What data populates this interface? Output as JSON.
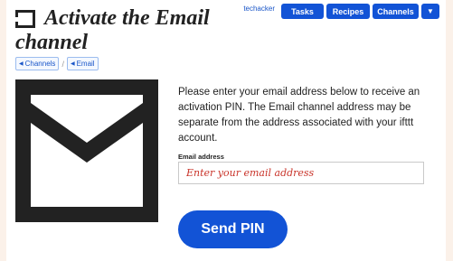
{
  "header": {
    "title_line1": "Activate the Email",
    "title_line2": "channel",
    "icon": "email-channel-icon"
  },
  "breadcrumbs": [
    {
      "label": "Channels"
    },
    {
      "label": "Email"
    }
  ],
  "topnav": {
    "user": "techacker",
    "tasks": "Tasks",
    "recipes": "Recipes",
    "channels": "Channels",
    "dropdown_icon": "caret-down-icon"
  },
  "main": {
    "instructions": "Please enter your email address below to receive an activation PIN. The Email channel address may be separate from the address associated with your ifttt account.",
    "email_label": "Email address",
    "email_placeholder": "Enter your email address",
    "email_value": "",
    "send_button": "Send PIN",
    "envelope_icon": "envelope-icon"
  },
  "colors": {
    "accent": "#1253d6",
    "placeholder": "#c9342a",
    "background": "#fbf1e9"
  }
}
